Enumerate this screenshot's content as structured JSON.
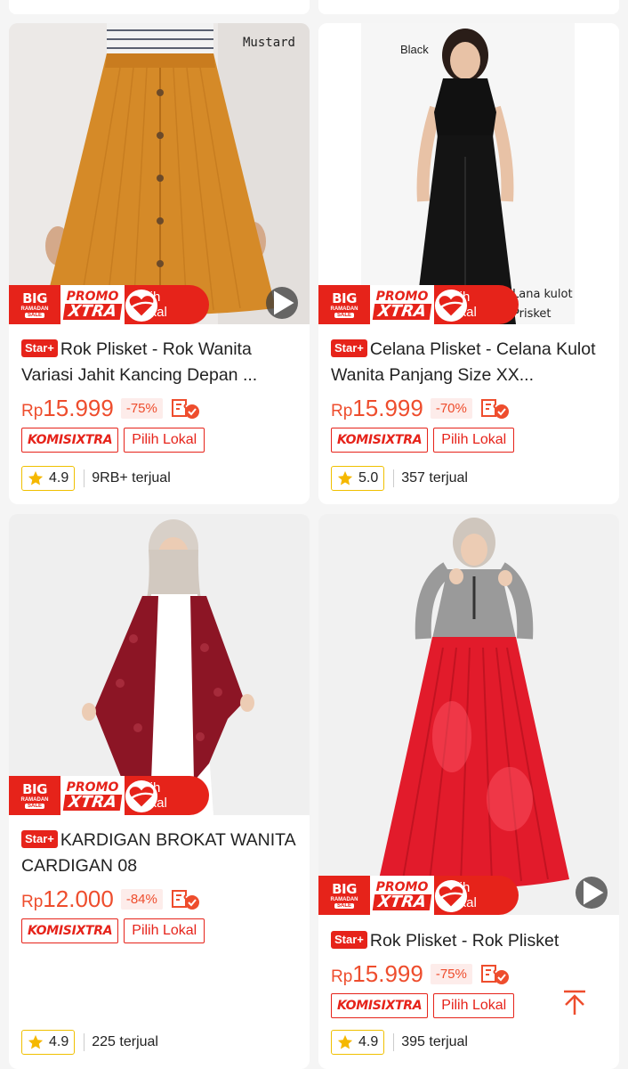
{
  "products": [
    {
      "color_label": "Mustard",
      "star_badge": "Star+",
      "title": "Rok Plisket - Rok Wanita Variasi Jahit Kancing Depan ...",
      "currency": "Rp",
      "price": "15.999",
      "discount": "-75%",
      "komisi_a": "KOMISI",
      "komisi_b": "XTRA",
      "pilih_lokal": "Pilih Lokal",
      "rating": "4.9",
      "sold": "9RB+ terjual",
      "has_video": true
    },
    {
      "color_label": "Black",
      "overlay_text": "Lana kulot Prisket",
      "star_badge": "Star+",
      "title": "Celana Plisket - Celana Kulot Wanita Panjang Size XX...",
      "currency": "Rp",
      "price": "15.999",
      "discount": "-70%",
      "komisi_a": "KOMISI",
      "komisi_b": "XTRA",
      "pilih_lokal": "Pilih Lokal",
      "rating": "5.0",
      "sold": "357 terjual",
      "has_video": false
    },
    {
      "star_badge": "Star+",
      "title": "KARDIGAN BROKAT WANITA CARDIGAN 08",
      "currency": "Rp",
      "price": "12.000",
      "discount": "-84%",
      "komisi_a": "KOMISI",
      "komisi_b": "XTRA",
      "pilih_lokal": "Pilih Lokal",
      "rating": "4.9",
      "sold": "225 terjual",
      "has_video": false
    },
    {
      "star_badge": "Star+",
      "title": "Rok Plisket - Rok Plisket",
      "currency": "Rp",
      "price": "15.999",
      "discount": "-75%",
      "komisi_a": "KOMISI",
      "komisi_b": "XTRA",
      "pilih_lokal": "Pilih Lokal",
      "rating": "4.9",
      "sold": "395 terjual",
      "has_video": true
    }
  ],
  "promo_band": {
    "big": "BIG",
    "ramadan": "RAMADAN",
    "sale": "SALE",
    "promo": "PROMO",
    "xtra": "XTRA",
    "pilih": "Pilih",
    "lokal": "Lokal"
  },
  "icons": {
    "play": "play-icon",
    "star": "star-icon",
    "cod": "cod-voucher-icon",
    "back_to_top": "arrow-up-icon"
  },
  "colors": {
    "accent": "#ee4d2d",
    "promo_red": "#e6231a",
    "rating_border": "#f0c000",
    "background": "#f5f5f5"
  }
}
